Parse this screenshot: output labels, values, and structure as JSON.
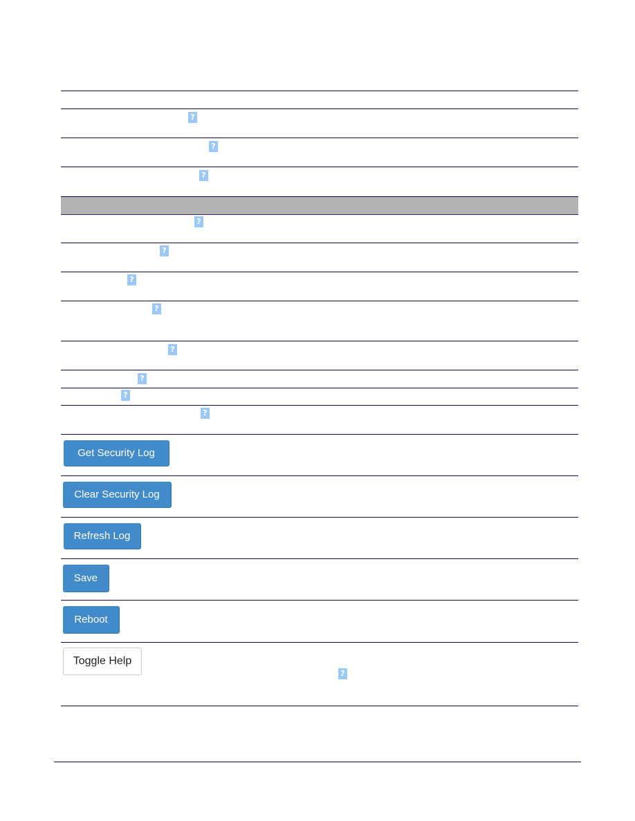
{
  "table": {
    "section_header": "",
    "rows": [
      {
        "label": "",
        "help_icon": "help-icon"
      },
      {
        "label": "",
        "help_icon": "help-icon"
      },
      {
        "label": "",
        "help_icon": "help-icon"
      },
      {
        "label": "",
        "help_icon": "help-icon"
      },
      {
        "label": "",
        "help_icon": "help-icon"
      },
      {
        "label": "",
        "help_icon": "help-icon"
      },
      {
        "label": "",
        "help_icon": "help-icon"
      },
      {
        "label": "",
        "help_icon": "help-icon"
      },
      {
        "label": "",
        "help_icon": "help-icon"
      },
      {
        "label": "",
        "help_icon": "help-icon"
      },
      {
        "label": "",
        "help_icon": "help-icon"
      }
    ],
    "help_glyph": "?"
  },
  "buttons": {
    "get_security_log": "Get Security Log",
    "clear_security_log": "Clear Security Log",
    "refresh_log": "Refresh Log",
    "save": "Save",
    "reboot": "Reboot",
    "toggle_help": "Toggle Help"
  },
  "colors": {
    "primary_button": "#428bca",
    "help_icon": "#9cc8f5",
    "rule_line": "#0d0a4a",
    "section_band": "#b3b3b3"
  }
}
